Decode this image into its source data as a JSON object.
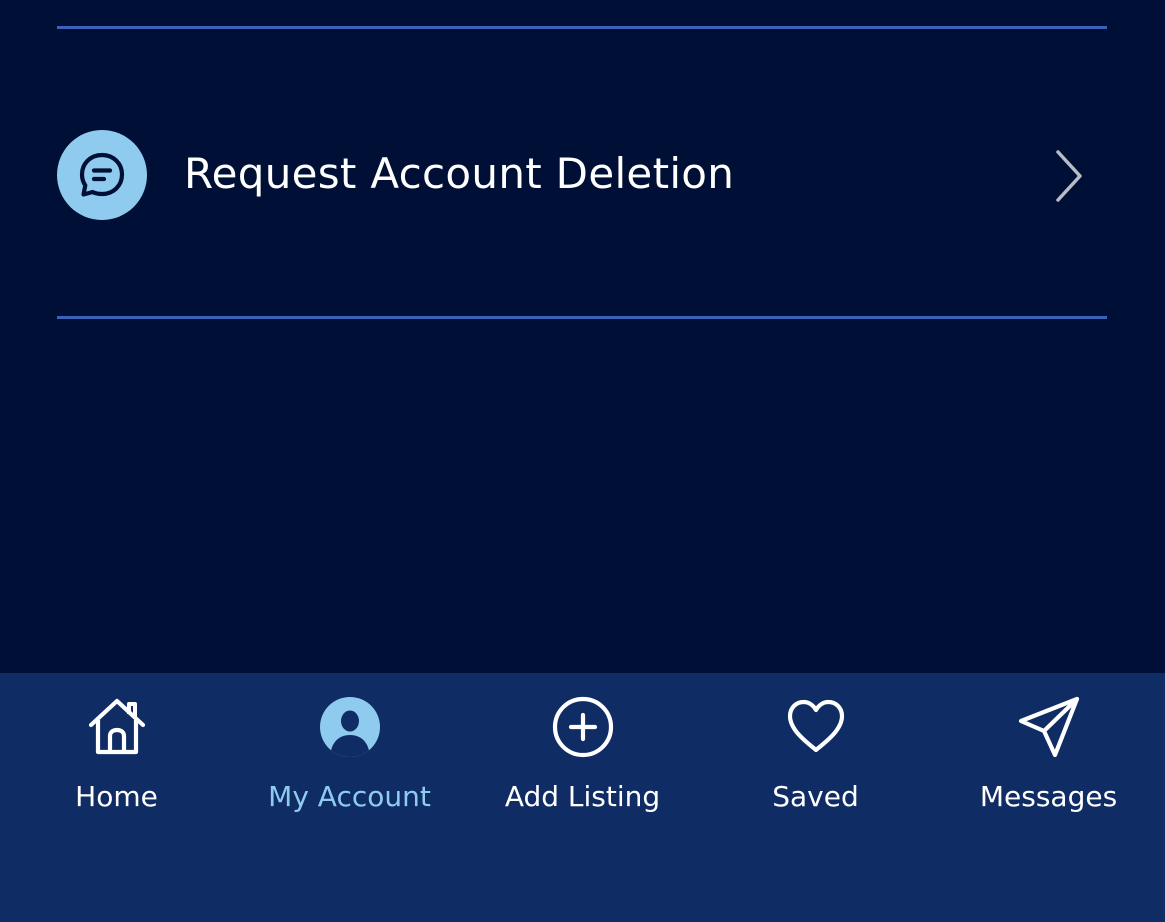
{
  "menu": {
    "items": [
      {
        "label": "Request Account Deletion",
        "icon": "chat-bubble-icon"
      }
    ]
  },
  "tabbar": {
    "tabs": [
      {
        "label": "Home",
        "icon": "home-icon",
        "active": false
      },
      {
        "label": "My Account",
        "icon": "user-avatar-icon",
        "active": true
      },
      {
        "label": "Add Listing",
        "icon": "plus-circle-icon",
        "active": false
      },
      {
        "label": "Saved",
        "icon": "heart-icon",
        "active": false
      },
      {
        "label": "Messages",
        "icon": "paper-plane-icon",
        "active": false
      }
    ]
  },
  "colors": {
    "background": "#000f35",
    "tabbar": "#102c64",
    "divider": "#3a63b8",
    "accent": "#8ecbef",
    "text": "#ffffff"
  }
}
